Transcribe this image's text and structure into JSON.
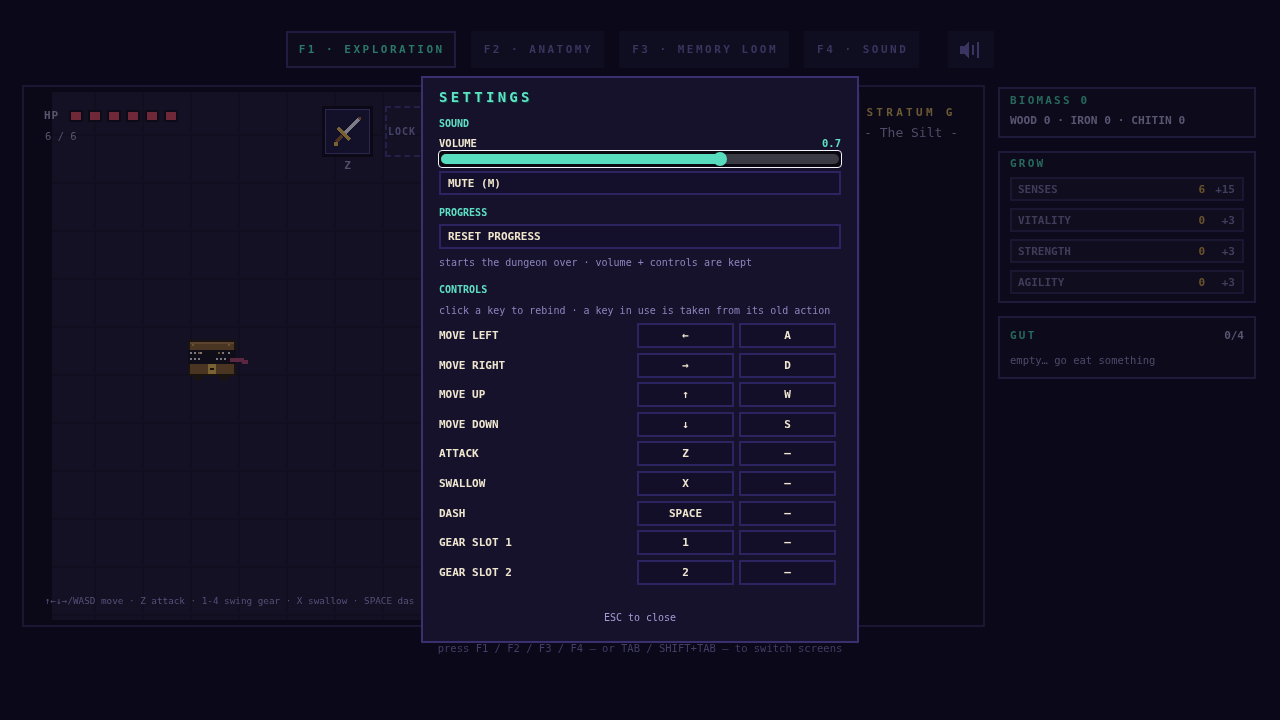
{
  "tabs": [
    {
      "label": "F1 · EXPLORATION",
      "selected": true
    },
    {
      "label": "F2 · ANATOMY",
      "selected": false
    },
    {
      "label": "F3 · MEMORY LOOM",
      "selected": false
    },
    {
      "label": "F4 · SOUND",
      "selected": false
    }
  ],
  "game": {
    "hp": {
      "label": "HP",
      "pips": [
        {
          "filled": true
        },
        {
          "filled": true
        },
        {
          "filled": true
        },
        {
          "filled": true
        },
        {
          "filled": true
        },
        {
          "filled": true
        }
      ],
      "reading": "6 / 6"
    },
    "gear_slots": [
      {
        "kind": "weapon",
        "key": "Z"
      },
      {
        "kind": "locked",
        "label": "LOCK"
      }
    ],
    "stratum": {
      "title": "STRATUM G",
      "subtitle": "- The Silt -"
    },
    "hint": "↑←↓→/WASD move · Z attack · 1-4 swing gear · X swallow · SPACE das"
  },
  "side": {
    "biomass": {
      "title": "BIOMASS 0",
      "materials": "WOOD 0 · IRON 0 · CHITIN 0"
    },
    "grow": {
      "title": "GROW",
      "stats": [
        {
          "name": "SENSES",
          "value": "6",
          "cost": "+15"
        },
        {
          "name": "VITALITY",
          "value": "0",
          "cost": "+3"
        },
        {
          "name": "STRENGTH",
          "value": "0",
          "cost": "+3"
        },
        {
          "name": "AGILITY",
          "value": "0",
          "cost": "+3"
        }
      ]
    },
    "gut": {
      "title": "GUT",
      "count": "0/4",
      "text": "empty… go eat something"
    }
  },
  "footer": "press F1 / F2 / F3 / F4 — or TAB / SHIFT+TAB — to switch screens",
  "settings": {
    "title": "SETTINGS",
    "sections": [
      {
        "kind": "sound",
        "heading": "SOUND",
        "volume": {
          "label": "VOLUME",
          "reading": "0.7",
          "level": 0.7,
          "focused": true
        },
        "button": "MUTE (M)"
      },
      {
        "kind": "progress",
        "heading": "PROGRESS",
        "button": "RESET PROGRESS",
        "note": "starts the dungeon over · volume + controls are kept"
      },
      {
        "kind": "controls",
        "heading": "CONTROLS",
        "note": "click a key to rebind · a key in use is taken from its old action",
        "bindings": [
          {
            "action": "MOVE LEFT",
            "keys": [
              "←",
              "A"
            ]
          },
          {
            "action": "MOVE RIGHT",
            "keys": [
              "→",
              "D"
            ]
          },
          {
            "action": "MOVE UP",
            "keys": [
              "↑",
              "W"
            ]
          },
          {
            "action": "MOVE DOWN",
            "keys": [
              "↓",
              "S"
            ]
          },
          {
            "action": "ATTACK",
            "keys": [
              "Z",
              "—"
            ]
          },
          {
            "action": "SWALLOW",
            "keys": [
              "X",
              "—"
            ]
          },
          {
            "action": "DASH",
            "keys": [
              "SPACE",
              "—"
            ]
          },
          {
            "action": "GEAR SLOT 1",
            "keys": [
              "1",
              "—"
            ]
          },
          {
            "action": "GEAR SLOT 2",
            "keys": [
              "2",
              "—"
            ]
          }
        ]
      }
    ],
    "close_hint": "ESC to close"
  }
}
